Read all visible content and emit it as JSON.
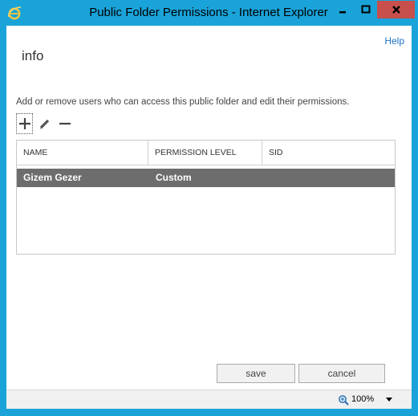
{
  "window": {
    "title": "Public Folder Permissions - Internet Explorer"
  },
  "header": {
    "help_label": "Help",
    "page_title": "info"
  },
  "main": {
    "description": "Add or remove users who can access this public folder and edit their permissions."
  },
  "toolbar": {
    "icons": [
      "plus-icon",
      "pencil-icon",
      "minus-icon"
    ]
  },
  "table": {
    "columns": [
      "NAME",
      "PERMISSION LEVEL",
      "SID"
    ],
    "rows": [
      {
        "name": "Gizem Gezer",
        "permission_level": "Custom",
        "sid": ""
      }
    ]
  },
  "footer": {
    "save_label": "save",
    "cancel_label": "cancel"
  },
  "statusbar": {
    "zoom": "100%"
  },
  "colors": {
    "frame": "#1aa3d9",
    "close_button": "#c7504c",
    "selected_row": "#6d6d6d",
    "link": "#1f72c4"
  }
}
